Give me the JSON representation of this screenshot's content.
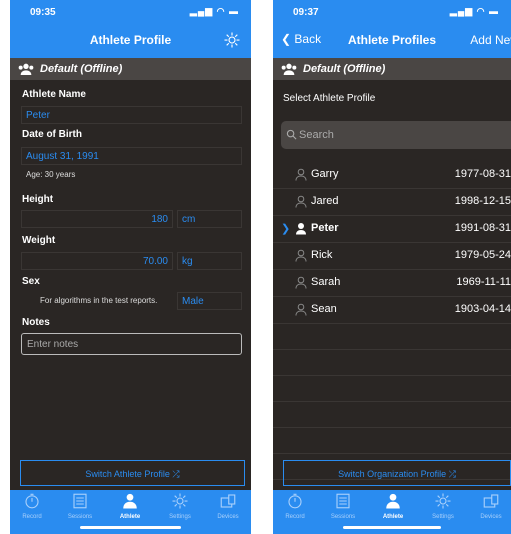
{
  "left": {
    "status_time": "09:35",
    "nav_title": "Athlete Profile",
    "org": "Default (Offline)",
    "name_label": "Athlete Name",
    "name_value": "Peter",
    "dob_label": "Date of Birth",
    "dob_value": "August 31, 1991",
    "age": "Age: 30 years",
    "height_label": "Height",
    "height_value": "180",
    "height_unit": "cm",
    "weight_label": "Weight",
    "weight_value": "70.00",
    "weight_unit": "kg",
    "sex_label": "Sex",
    "sex_note": "For algorithms in the test reports.",
    "sex_value": "Male",
    "notes_label": "Notes",
    "notes_placeholder": "Enter notes",
    "switch_label": "Switch Athlete Profile"
  },
  "right": {
    "status_time": "09:37",
    "back_label": "Back",
    "nav_title": "Athlete Profiles",
    "add_label": "Add New",
    "org": "Default (Offline)",
    "select_header": "Select Athlete Profile",
    "search_placeholder": "Search",
    "athletes": [
      {
        "name": "Garry",
        "date": "1977-08-31"
      },
      {
        "name": "Jared",
        "date": "1998-12-15"
      },
      {
        "name": "Peter",
        "date": "1991-08-31"
      },
      {
        "name": "Rick",
        "date": "1979-05-24"
      },
      {
        "name": "Sarah",
        "date": "1969-11-11"
      },
      {
        "name": "Sean",
        "date": "1903-04-14"
      }
    ],
    "selected_index": 2,
    "switch_label": "Switch Organization Profile"
  },
  "tabs": [
    {
      "label": "Record",
      "icon": "stopwatch-icon"
    },
    {
      "label": "Sessions",
      "icon": "list-icon"
    },
    {
      "label": "Athlete",
      "icon": "person-icon"
    },
    {
      "label": "Settings",
      "icon": "gear-icon"
    },
    {
      "label": "Devices",
      "icon": "devices-icon"
    }
  ],
  "active_tab": 2,
  "colors": {
    "accent": "#2a8cf0",
    "background": "#2a2624",
    "bar": "#4a4644"
  }
}
